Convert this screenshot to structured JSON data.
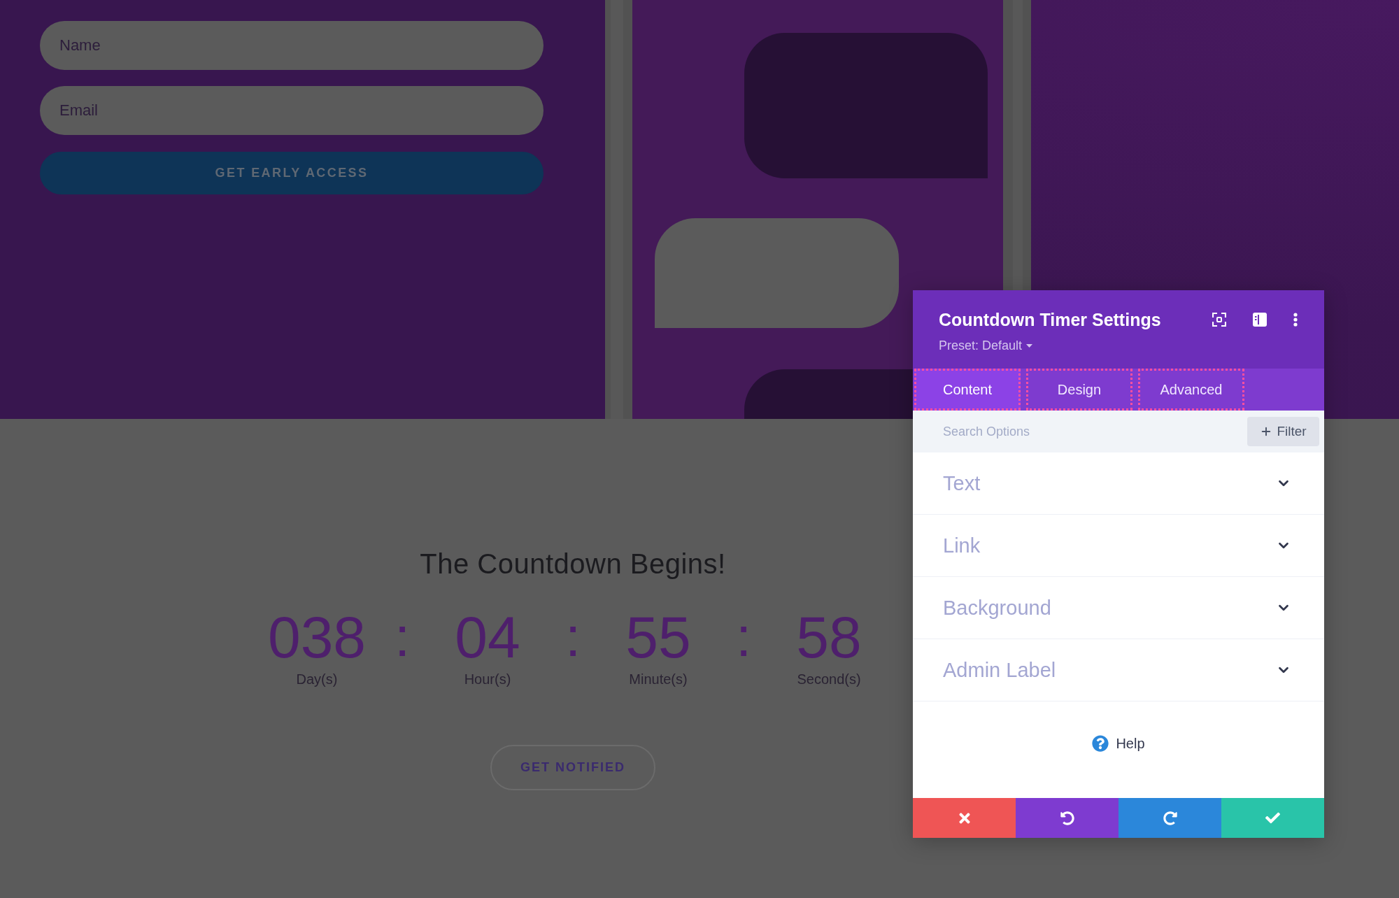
{
  "signup_form": {
    "fields": [
      {
        "placeholder": "Name"
      },
      {
        "placeholder": "Email"
      }
    ],
    "button": "GET EARLY ACCESS"
  },
  "countdown": {
    "title": "The Countdown Begins!",
    "units": [
      {
        "value": "038",
        "label": "Day(s)"
      },
      {
        "value": "04",
        "label": "Hour(s)"
      },
      {
        "value": "55",
        "label": "Minute(s)"
      },
      {
        "value": "58",
        "label": "Second(s)"
      }
    ],
    "separators": [
      ":",
      ":",
      ":"
    ],
    "button": "GET NOTIFIED"
  },
  "settings_panel": {
    "title": "Countdown Timer Settings",
    "preset": "Preset: Default",
    "tabs": [
      {
        "label": "Content",
        "selected": true
      },
      {
        "label": "Design",
        "selected": false
      },
      {
        "label": "Advanced",
        "selected": false
      }
    ],
    "search": {
      "placeholder": "Search Options"
    },
    "filter_button": "Filter",
    "sections": [
      {
        "label": "Text",
        "expanded": false
      },
      {
        "label": "Link",
        "expanded": false
      },
      {
        "label": "Background",
        "expanded": false
      },
      {
        "label": "Admin Label",
        "expanded": false
      }
    ],
    "help": "Help",
    "footer_buttons": [
      {
        "kind": "discard",
        "color": "#ef5555"
      },
      {
        "kind": "undo",
        "color": "#7e3bd0"
      },
      {
        "kind": "redo",
        "color": "#2b87da"
      },
      {
        "kind": "save",
        "color": "#29c4a9"
      }
    ]
  }
}
